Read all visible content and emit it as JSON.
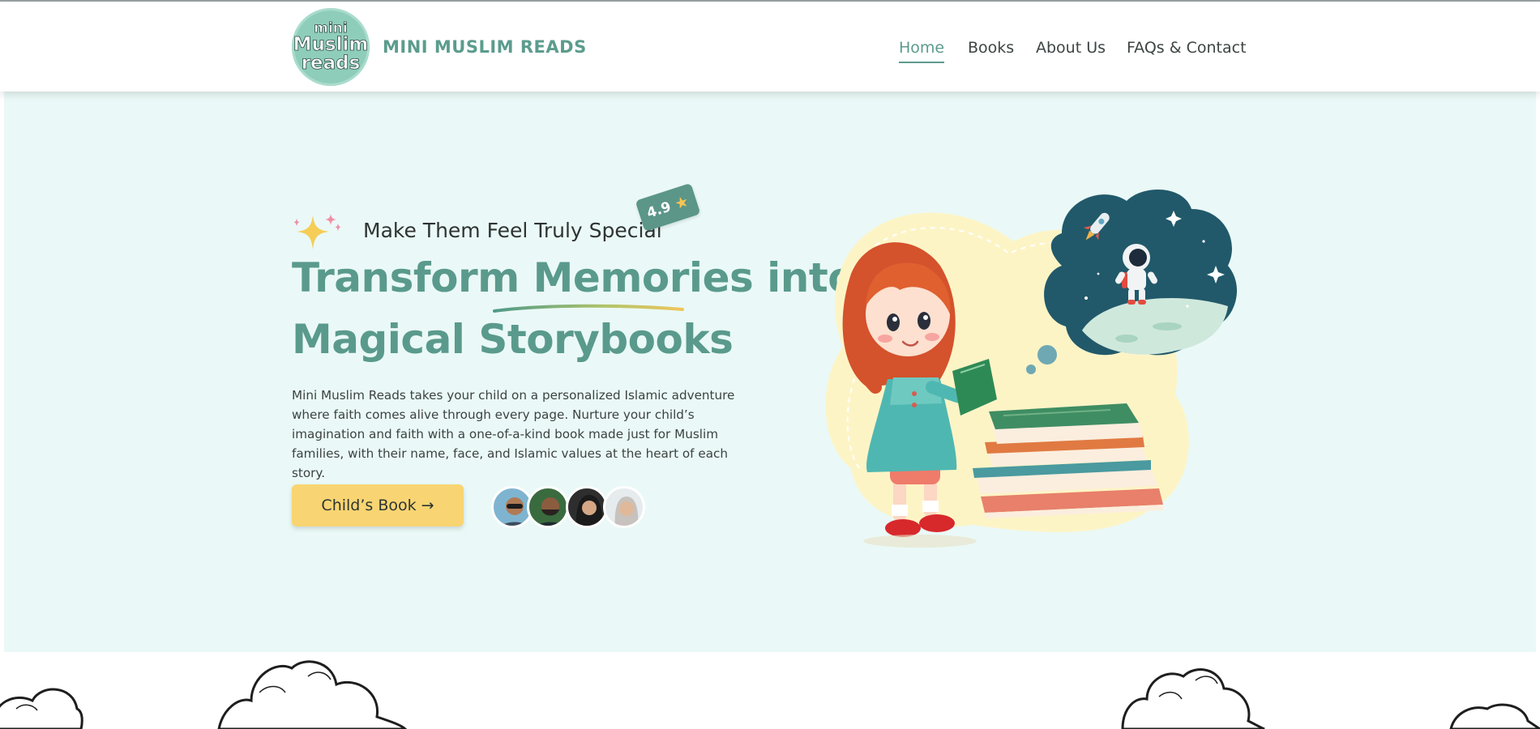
{
  "header": {
    "logo_lines": [
      "mini",
      "Muslim",
      "reads",
      "•!•"
    ],
    "brand": "MINI MUSLIM READS",
    "nav": [
      {
        "label": "Home",
        "active": true
      },
      {
        "label": "Books",
        "active": false
      },
      {
        "label": "About Us",
        "active": false
      },
      {
        "label": "FAQs & Contact",
        "active": false
      }
    ]
  },
  "hero": {
    "tagline": "Make Them Feel Truly Special",
    "rating": {
      "value": "4.9",
      "icon": "star-icon"
    },
    "headline_words": [
      "Transform",
      "Memories",
      "into",
      "Magical Storybooks"
    ],
    "description": "Mini Muslim Reads takes your child on a personalized Islamic adventure where faith comes alive through every page. Nurture your child’s imagination and faith with a one-of-a-kind book made just for Muslim families, with their name, face, and Islamic values at the heart of each story.",
    "cta_label": "Child’s Book →",
    "avatars_count": 4
  },
  "colors": {
    "brand_teal": "#5b9c8d",
    "hero_bg": "#eaf9f7",
    "cta_yellow": "#f8d572"
  }
}
